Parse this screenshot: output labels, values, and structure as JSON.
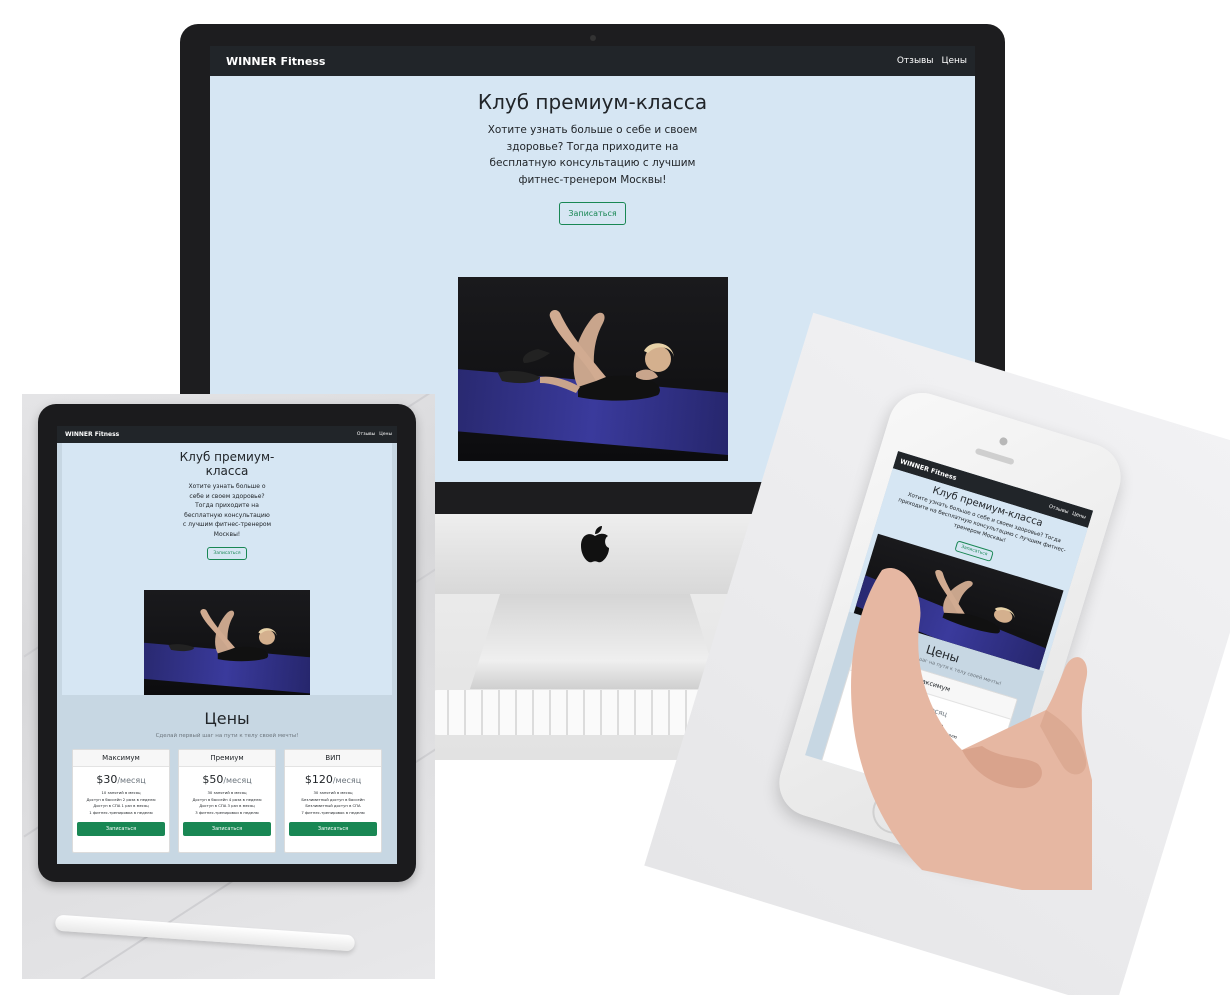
{
  "site": {
    "brand": "WINNER Fitness",
    "nav_links": [
      "Отзывы",
      "Цены"
    ]
  },
  "hero": {
    "title": "Клуб премиум-класса",
    "text": "Хотите узнать больше о себе и своем здоровье? Тогда приходите на бесплатную консультацию с лучшим фитнес-тренером Москвы!",
    "button": "Записаться"
  },
  "pricing": {
    "title": "Цены",
    "lead": "Сделай первый шаг на пути к телу своей мечты!",
    "per": "/месяц",
    "plans": [
      {
        "name": "Максимум",
        "price": "$30",
        "features": [
          "10 занятий в месяц",
          "Доступ в бассейн 2 раза в неделю",
          "Доступ в СПА 1 раз в месяц",
          "1 фитнес-тренировка в неделю"
        ],
        "button": "Записаться"
      },
      {
        "name": "Премиум",
        "price": "$50",
        "features": [
          "30 занятий в месяц",
          "Доступ в бассейн 4 раза в неделю",
          "Доступ в СПА 3 раз в месяц",
          "3 фитнес-тренировки в неделю"
        ],
        "button": "Записаться"
      },
      {
        "name": "ВИП",
        "price": "$120",
        "features": [
          "30 занятий в месяц",
          "Безлимитный доступ в бассейн",
          "Безлимитный доступ в СПА",
          "7 фитнес-тренировок в неделю"
        ],
        "button": "Записаться"
      }
    ]
  },
  "icons": {
    "apple_logo": "apple-logo-icon",
    "camera": "camera-icon"
  },
  "colors": {
    "navbar": "#212529",
    "hero_bg": "#d6e6f3",
    "pricing_bg": "#c7d7e3",
    "success": "#198754"
  }
}
